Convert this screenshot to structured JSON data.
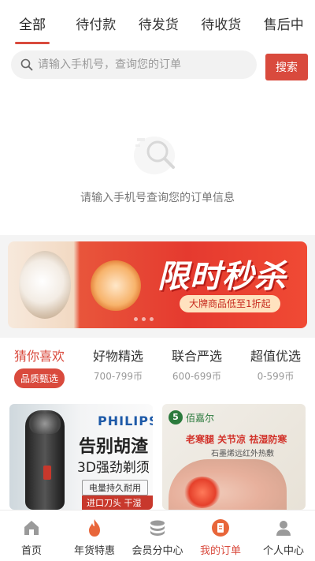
{
  "tabs": [
    {
      "label": "全部"
    },
    {
      "label": "待付款"
    },
    {
      "label": "待发货"
    },
    {
      "label": "待收货"
    },
    {
      "label": "售后中"
    }
  ],
  "search": {
    "placeholder": "请输入手机号，查询您的订单",
    "button_label": "搜索"
  },
  "empty_state": {
    "message": "请输入手机号查询您的订单信息"
  },
  "banner": {
    "title": "限时秒杀",
    "subtitle": "大牌商品低至1折起"
  },
  "categories": [
    {
      "title": "猜你喜欢",
      "subtitle": "品质甄选"
    },
    {
      "title": "好物精选",
      "subtitle": "700-799币"
    },
    {
      "title": "联合严选",
      "subtitle": "600-699币"
    },
    {
      "title": "超值优选",
      "subtitle": "0-599币"
    }
  ],
  "products": [
    {
      "brand": "PHILIPS",
      "title": "告别胡渣",
      "subtitle": "3D强劲剃须",
      "tag1": "电量持久耐用",
      "tag2": "进口刀头 干湿双剃"
    },
    {
      "brand": "佰嘉尔",
      "tags": "老寒腿 关节凉 祛湿防寒",
      "subtitle": "石墨烯远红外热敷"
    }
  ],
  "bottom_nav": [
    {
      "label": "首页",
      "icon": "home-icon"
    },
    {
      "label": "年货特惠",
      "icon": "fire-icon"
    },
    {
      "label": "会员分中心",
      "icon": "coins-icon"
    },
    {
      "label": "我的订单",
      "icon": "order-icon"
    },
    {
      "label": "个人中心",
      "icon": "person-icon"
    }
  ],
  "colors": {
    "accent": "#d94a3d"
  }
}
